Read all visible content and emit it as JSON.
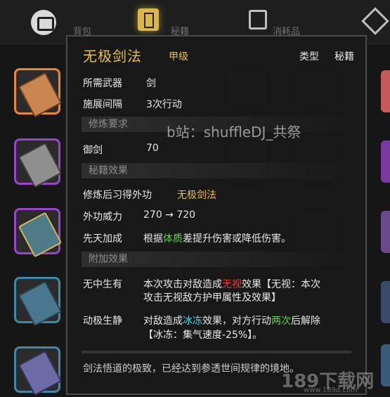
{
  "tabs": [
    {
      "label": "背包"
    },
    {
      "label": "秘籍"
    },
    {
      "label": "消耗品"
    }
  ],
  "tooltip": {
    "title": "无极剑法",
    "grade": "甲级",
    "type_label": "类型",
    "type_value": "秘籍",
    "weapon_label": "所需武器",
    "weapon_value": "剑",
    "interval_label": "施展间隔",
    "interval_value": "3次行动",
    "sec_requirements": "修炼要求",
    "req_label": "御剑",
    "req_value": "70",
    "sec_effects": "秘籍效果",
    "gain_label": "修炼后习得外功",
    "gain_value": "无极剑法",
    "power_label": "外功威力",
    "power_value": "270 → 720",
    "innate_label": "先天加成",
    "innate_pre": "根据",
    "innate_hl": "体质",
    "innate_post": "差提升伤害或降低伤害。",
    "sec_extra": "附加效果",
    "e1_label": "无中生有",
    "e1_a": "本次攻击对敌造成",
    "e1_hl": "无视",
    "e1_b": "效果【无视：本次",
    "e1_c": "攻击无视敌方护甲属性及效果】",
    "e2_label": "动极生静",
    "e2_a": "对敌造成",
    "e2_hl1": "冰冻",
    "e2_b": "效果，对方行动",
    "e2_hl2": "两次",
    "e2_c": "后解除",
    "e2_d": "【冰冻：集气速度-25%】。",
    "flavor": "剑法悟道的极致，已经达到参透世间规律的境地。"
  },
  "watermark": "b站：shuffleDJ_共祭",
  "watermark2": "189下载网",
  "watermark2_url": "www.189d.com",
  "colors": {
    "gold": "#e6bf4a",
    "green": "#5ed24b",
    "red": "#ee3a3a",
    "cyan": "#4fd7e8"
  }
}
